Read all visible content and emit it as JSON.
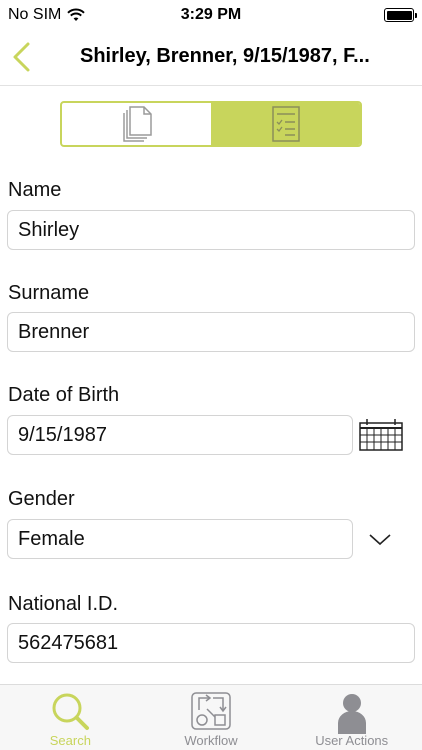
{
  "status_bar": {
    "carrier": "No SIM",
    "time": "3:29 PM"
  },
  "nav": {
    "title": "Shirley, Brenner, 9/15/1987, F..."
  },
  "segments": [
    {
      "name": "documents"
    },
    {
      "name": "form"
    }
  ],
  "form": {
    "name_label": "Name",
    "name_value": "Shirley",
    "surname_label": "Surname",
    "surname_value": "Brenner",
    "dob_label": "Date of Birth",
    "dob_value": "9/15/1987",
    "gender_label": "Gender",
    "gender_value": "Female",
    "national_id_label": "National I.D.",
    "national_id_value": "562475681"
  },
  "tabs": [
    {
      "label": "Search",
      "icon": "search-icon",
      "active": true
    },
    {
      "label": "Workflow",
      "icon": "workflow-icon",
      "active": false
    },
    {
      "label": "User Actions",
      "icon": "user-icon",
      "active": false
    }
  ],
  "colors": {
    "accent": "#c8d55c",
    "tab_inactive": "#8e8e93",
    "border": "#d4d4d4"
  }
}
